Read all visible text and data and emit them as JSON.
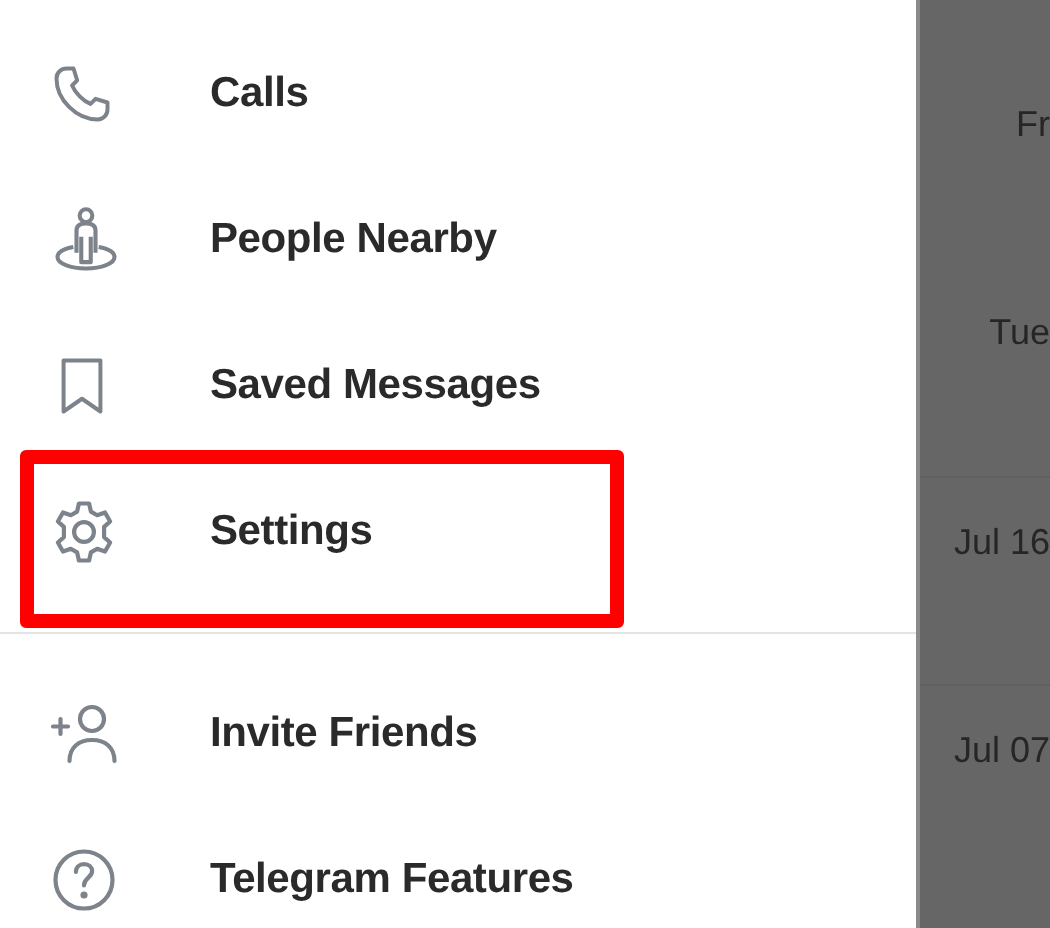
{
  "drawer": {
    "sections": [
      {
        "items": [
          {
            "label": "Calls",
            "highlighted": false
          },
          {
            "label": "People Nearby",
            "highlighted": false
          },
          {
            "label": "Saved Messages",
            "highlighted": false
          },
          {
            "label": "Settings",
            "highlighted": true
          }
        ]
      },
      {
        "items": [
          {
            "label": "Invite Friends",
            "highlighted": false
          },
          {
            "label": "Telegram Features",
            "highlighted": false
          }
        ]
      }
    ]
  },
  "chat_list": {
    "dates": [
      "Fr",
      "Tue",
      "Jul 16",
      "Jul 07"
    ]
  }
}
